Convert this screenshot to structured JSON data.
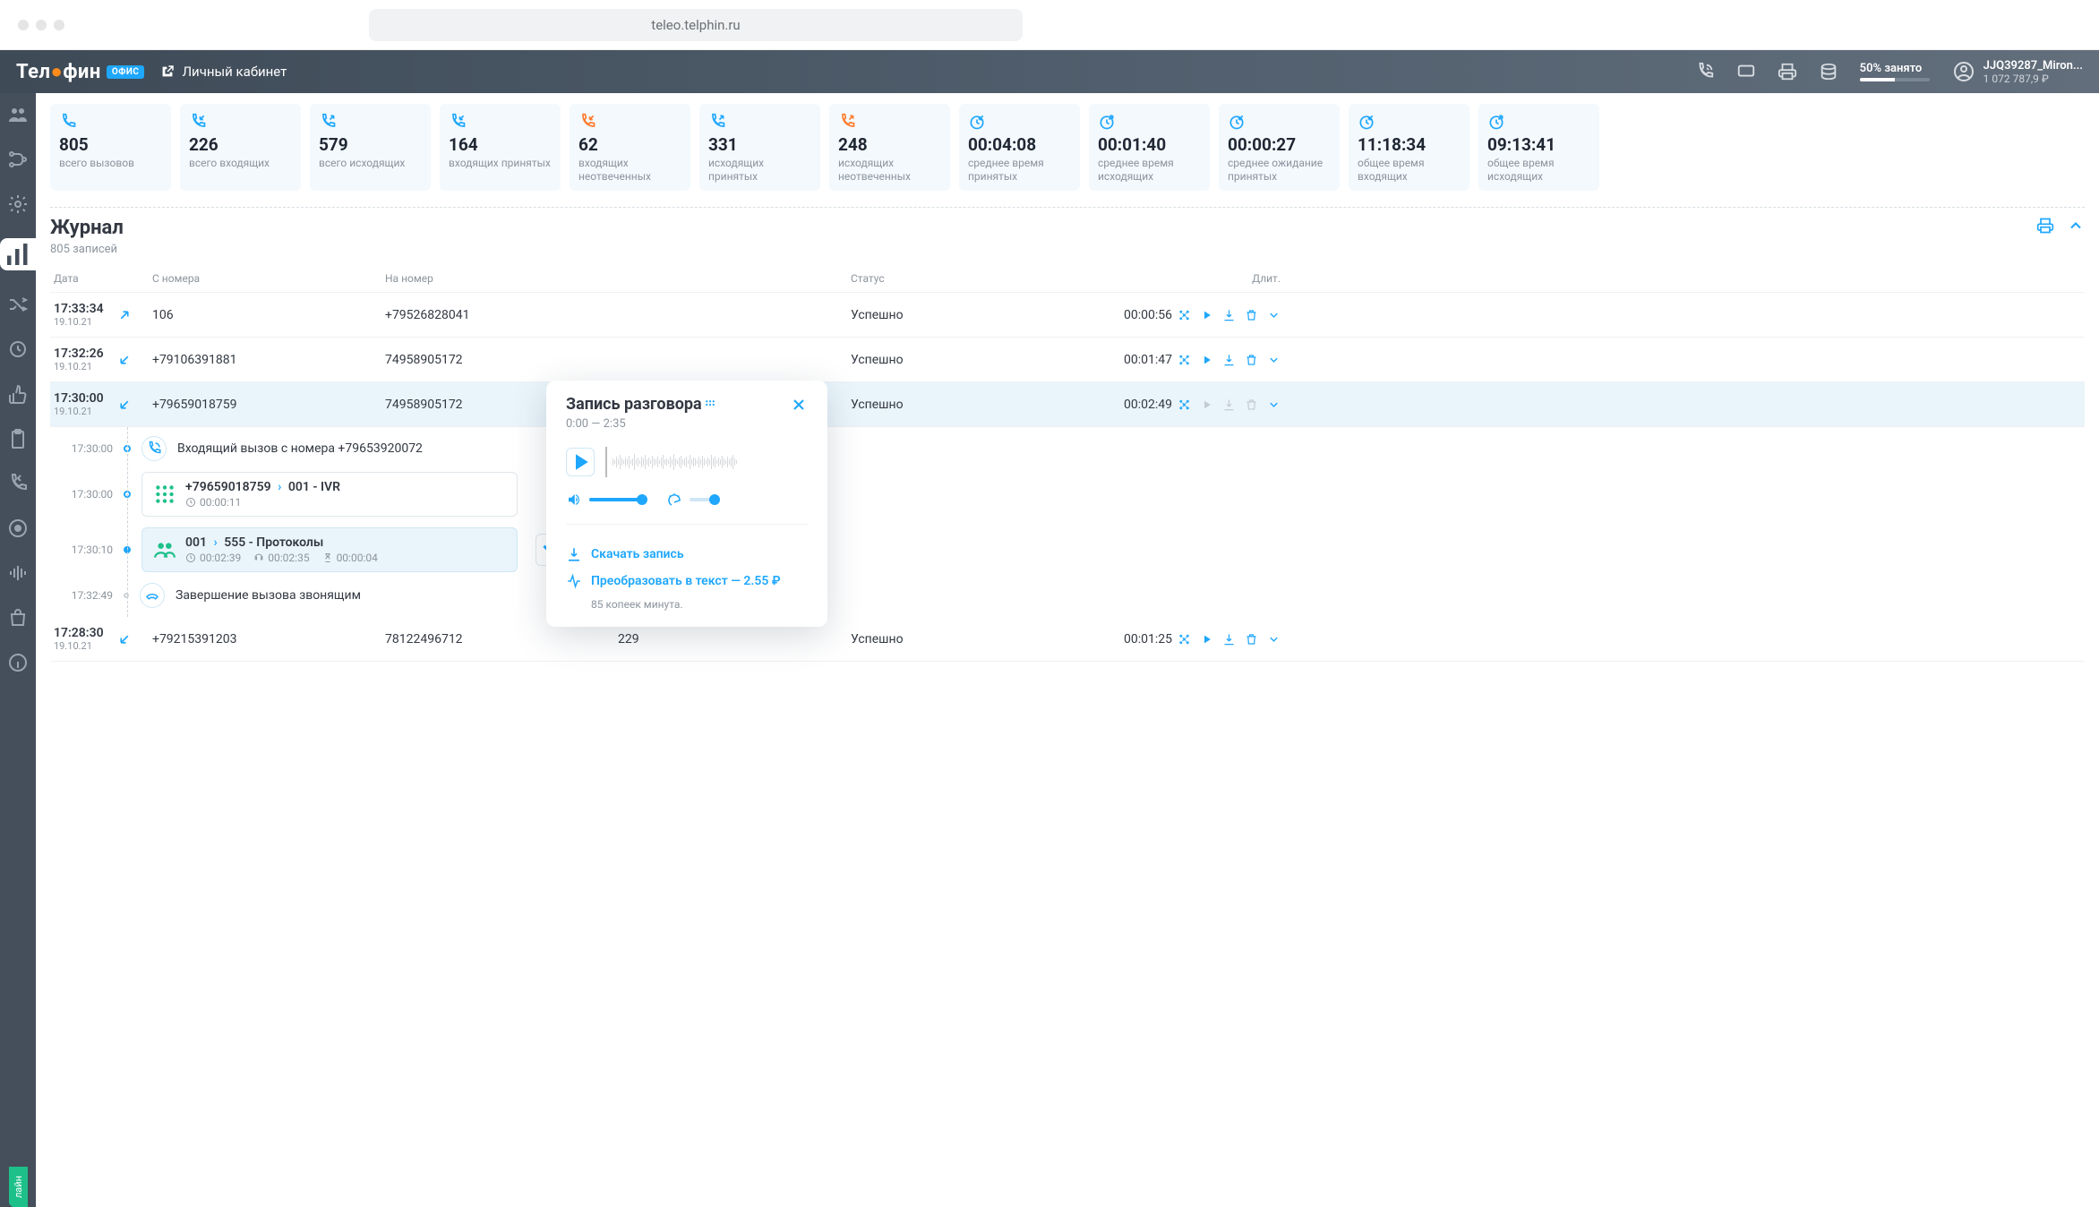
{
  "browser": {
    "url": "teleo.telphin.ru"
  },
  "header": {
    "logo_text_pre": "Тел",
    "logo_text_post": "фин",
    "logo_badge": "ОФИС",
    "cabinet": "Личный кабинет",
    "storage_label": "50% занято",
    "user_name": "JJQ39287_Miron...",
    "user_balance": "1 072 787,9 ₽"
  },
  "side_tab": "лайн",
  "stats": [
    {
      "icon": "phone",
      "value": "805",
      "label": "всего вызовов",
      "accent": "#1ea7fd"
    },
    {
      "icon": "phone-in",
      "value": "226",
      "label": "всего входящих",
      "accent": "#1ea7fd"
    },
    {
      "icon": "phone-out",
      "value": "579",
      "label": "всего исходящих",
      "accent": "#1ea7fd"
    },
    {
      "icon": "phone-in",
      "value": "164",
      "label": "входящих принятых",
      "accent": "#1ea7fd"
    },
    {
      "icon": "phone-in",
      "value": "62",
      "label": "входящих неотвеченных",
      "accent": "#ff7a2b"
    },
    {
      "icon": "phone-out",
      "value": "331",
      "label": "исходящих принятых",
      "accent": "#1ea7fd"
    },
    {
      "icon": "phone-out",
      "value": "248",
      "label": "исходящих неотвеченных",
      "accent": "#ff7a2b"
    },
    {
      "icon": "clock-in",
      "value": "00:04:08",
      "label": "среднее время принятых",
      "accent": "#1ea7fd"
    },
    {
      "icon": "clock-out",
      "value": "00:01:40",
      "label": "среднее время исходящих",
      "accent": "#1ea7fd"
    },
    {
      "icon": "clock-in",
      "value": "00:00:27",
      "label": "среднее ожидание принятых",
      "accent": "#1ea7fd"
    },
    {
      "icon": "clock-in",
      "value": "11:18:34",
      "label": "общее время входящих",
      "accent": "#1ea7fd"
    },
    {
      "icon": "clock-out",
      "value": "09:13:41",
      "label": "общее время исходящих",
      "accent": "#1ea7fd"
    }
  ],
  "journal": {
    "title": "Журнал",
    "sub": "805 записей",
    "cols": {
      "date": "Дата",
      "from": "С номера",
      "to": "На номер",
      "status": "Статус",
      "dur": "Длит."
    },
    "rows": [
      {
        "time": "17:33:34",
        "date": "19.10.21",
        "dir": "out",
        "from": "106",
        "to": "+79526828041",
        "status": "Успешно",
        "dur": "00:00:56"
      },
      {
        "time": "17:32:26",
        "date": "19.10.21",
        "dir": "in",
        "from": "+79106391881",
        "to": "74958905172",
        "status": "Успешно",
        "dur": "00:01:47"
      },
      {
        "time": "17:30:00",
        "date": "19.10.21",
        "dir": "in",
        "from": "+79659018759",
        "to": "74958905172",
        "status": "Успешно",
        "dur": "00:02:49",
        "selected": true
      },
      {
        "time": "17:28:30",
        "date": "19.10.21",
        "dir": "in",
        "from": "+79215391203",
        "to": "78122496712",
        "ext": "229",
        "status": "Успешно",
        "dur": "00:01:25"
      }
    ],
    "detail": {
      "steps": [
        {
          "time": "17:30:00",
          "kind": "start",
          "text": "Входящий вызов с номера +79653920072"
        },
        {
          "time": "17:30:00",
          "kind": "ivr",
          "from": "+79659018759",
          "to": "001 - IVR",
          "d1": "00:00:11"
        },
        {
          "time": "17:30:10",
          "kind": "group",
          "from": "001",
          "to": "555 - Протоколы",
          "d1": "00:02:39",
          "d2": "00:02:35",
          "d3": "00:00:04",
          "active": true
        },
        {
          "time": "17:32:49",
          "kind": "end",
          "text": "Завершение вызова звонящим"
        }
      ]
    }
  },
  "popover": {
    "title": "Запись разговора",
    "range": "0:00 — 2:35",
    "download": "Скачать запись",
    "transcribe": "Преобразовать в текст — 2.55 ₽",
    "note": "85 копеек минута."
  }
}
